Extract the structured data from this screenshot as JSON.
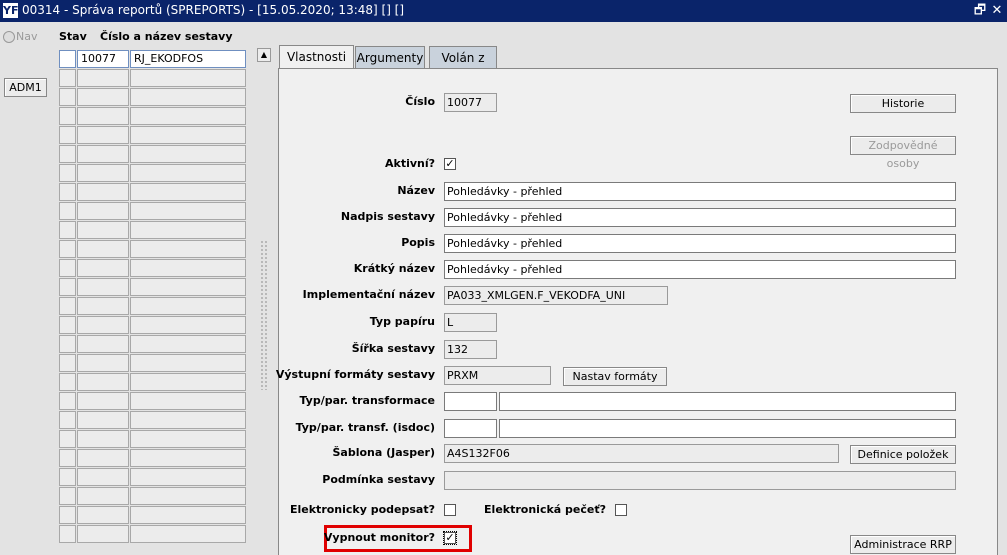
{
  "window": {
    "title": "00314 - Správa reportů (SPREPORTS) - [15.05.2020; 13:48] [] []",
    "restore_glyph": "🗗",
    "close_glyph": "✕",
    "app_icon": "YF"
  },
  "left": {
    "nav_label": "Nav",
    "adm_button": "ADM1"
  },
  "grid": {
    "header_stav": "Stav",
    "header_name": "Číslo a název sestavy",
    "first_row": {
      "number": "10077",
      "code": "RJ_EKODFOS"
    },
    "scroll_up_glyph": "▲"
  },
  "tabs": [
    "Vlastnosti",
    "Argumenty",
    "Volán z"
  ],
  "form": {
    "cislo_label": "Číslo",
    "cislo": "10077",
    "historie_button": "Historie",
    "zodpovedne_button": "Zodpovědné osoby",
    "aktivni_label": "Aktivní?",
    "aktivni_check": "✓",
    "nazev_label": "Název",
    "nazev": "Pohledávky - přehled",
    "nadpis_label": "Nadpis sestavy",
    "nadpis": "Pohledávky - přehled",
    "popis_label": "Popis",
    "popis": "Pohledávky - přehled",
    "kratky_label": "Krátký název",
    "kratky": "Pohledávky - přehled",
    "impl_label": "Implementační název",
    "impl": "PA033_XMLGEN.F_VEKODFA_UNI",
    "typ_papiru_label": "Typ papíru",
    "typ_papiru": "L",
    "sirka_label": "Šířka sestavy",
    "sirka": "132",
    "vystupni_label": "Výstupní formáty sestavy",
    "vystupni": "PRXM",
    "nastav_button": "Nastav formáty",
    "typ_transf_label": "Typ/par. transformace",
    "typ_transf_isdoc_label": "Typ/par. transf. (isdoc)",
    "sablona_label": "Šablona (Jasper)",
    "sablona": "A4S132F06",
    "definice_button": "Definice položek",
    "podminka_label": "Podmínka sestavy",
    "el_podepsat_label": "Elektronicky podepsat?",
    "el_pecet_label": "Elektronická pečeť?",
    "vypnout_label": "Vypnout monitor?",
    "vypnout_check": "✓",
    "administrace_button": "Administrace RRP"
  }
}
